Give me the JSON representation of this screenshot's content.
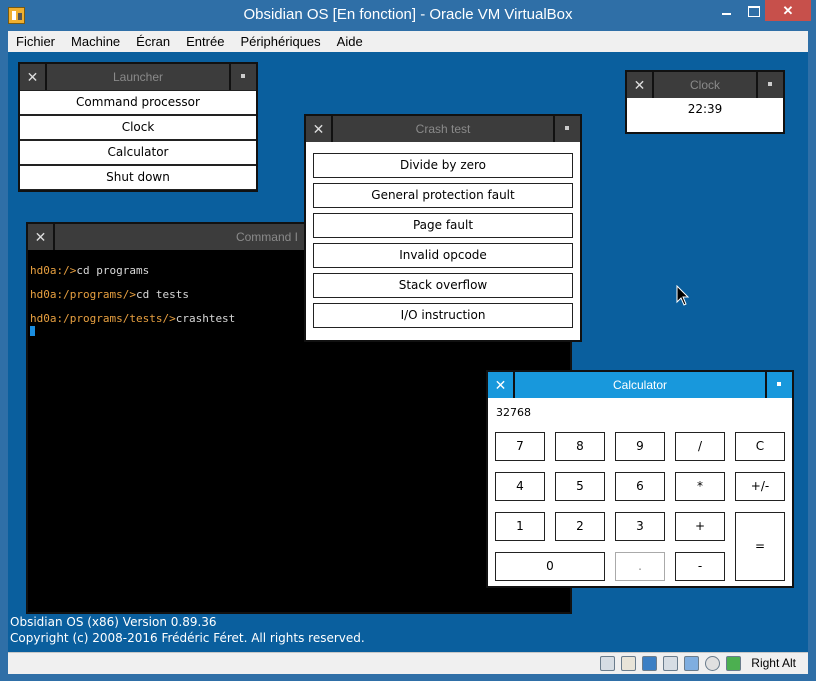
{
  "host": {
    "title": "Obsidian OS [En fonction] - Oracle VM VirtualBox",
    "menu": [
      "Fichier",
      "Machine",
      "Écran",
      "Entrée",
      "Périphériques",
      "Aide"
    ],
    "host_key": "Right Alt",
    "status_icons": [
      "usb-icon",
      "shared-folder-icon",
      "display-icon",
      "network-icon",
      "video-capture-icon",
      "optical-drive-icon",
      "mouse-integration-icon",
      "keyboard-capture-icon"
    ]
  },
  "launcher": {
    "title": "Launcher",
    "items": [
      "Command processor",
      "Clock",
      "Calculator",
      "Shut down"
    ]
  },
  "clock": {
    "title": "Clock",
    "time": "22:39"
  },
  "command": {
    "title": "Command processor",
    "title_visible": "Command I",
    "lines": [
      {
        "prompt": "hd0a:/>",
        "text": "cd programs"
      },
      {
        "prompt": "hd0a:/programs/>",
        "text": "cd tests"
      },
      {
        "prompt": "hd0a:/programs/tests/>",
        "text": "crashtest"
      }
    ]
  },
  "crashtest": {
    "title": "Crash test",
    "buttons": [
      "Divide by zero",
      "General protection fault",
      "Page fault",
      "Invalid opcode",
      "Stack overflow",
      "I/O instruction"
    ]
  },
  "calculator": {
    "title": "Calculator",
    "display": "32768",
    "keys": [
      "7",
      "8",
      "9",
      "/",
      "C",
      "4",
      "5",
      "6",
      "*",
      "+/-",
      "1",
      "2",
      "3",
      "+",
      "=",
      "0",
      ".",
      "-"
    ]
  },
  "footer": {
    "version": "Obsidian OS (x86) Version 0.89.36",
    "copyright": "Copyright (c) 2008-2016 Frédéric Féret. All rights reserved."
  },
  "colors": {
    "host_chrome": "#2f6fa7",
    "guest_desktop": "#0a5f9e",
    "calculator_title": "#1898dc",
    "prompt": "#e8a040",
    "cursor": "#1a8ee0"
  }
}
